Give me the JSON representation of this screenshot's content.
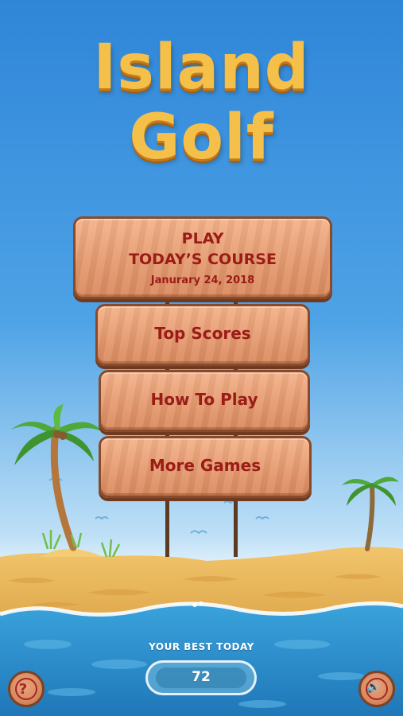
{
  "title": {
    "line1": "Island",
    "line2": "Golf"
  },
  "menu": {
    "play": {
      "line1": "PLAY",
      "line2": "TODAY’S COURSE",
      "date": "Janurary 24, 2018"
    },
    "top_scores": "Top Scores",
    "how_to_play": "How To Play",
    "more_games": "More Games"
  },
  "best": {
    "label": "YOUR BEST TODAY",
    "value": "72"
  },
  "buttons": {
    "help_glyph": "?",
    "sound_glyph": "🔊"
  },
  "icons": {
    "help": "question-icon",
    "sound": "speaker-icon"
  },
  "colors": {
    "title": "#f5c04a",
    "sign_text": "#9b1b17",
    "sky": "#3d93df",
    "sea": "#2f8fd0",
    "sand": "#e6b359"
  }
}
